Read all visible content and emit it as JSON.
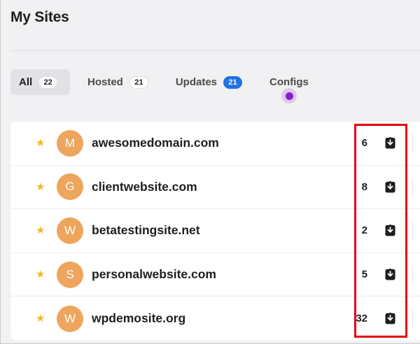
{
  "page": {
    "title": "My Sites"
  },
  "tabs": [
    {
      "label": "All",
      "count": "22",
      "active": true
    },
    {
      "label": "Hosted",
      "count": "21",
      "active": false
    },
    {
      "label": "Updates",
      "count": "21",
      "active": false,
      "badge_color": "#2271e5"
    },
    {
      "label": "Configs",
      "active": false
    }
  ],
  "sites": [
    {
      "initial": "M",
      "name": "awesomedomain.com",
      "count": "6"
    },
    {
      "initial": "G",
      "name": "clientwebsite.com",
      "count": "8"
    },
    {
      "initial": "W",
      "name": "betatestingsite.net",
      "count": "2"
    },
    {
      "initial": "S",
      "name": "personalwebsite.com",
      "count": "5"
    },
    {
      "initial": "W",
      "name": "wpdemosite.org",
      "count": "32"
    }
  ],
  "colors": {
    "star": "#f2b81c",
    "avatar": "#eea55d",
    "highlight": "#e8000b",
    "configs_dot": "#8d1ec7"
  },
  "icons": {
    "star": "star-icon",
    "download": "download-icon"
  }
}
